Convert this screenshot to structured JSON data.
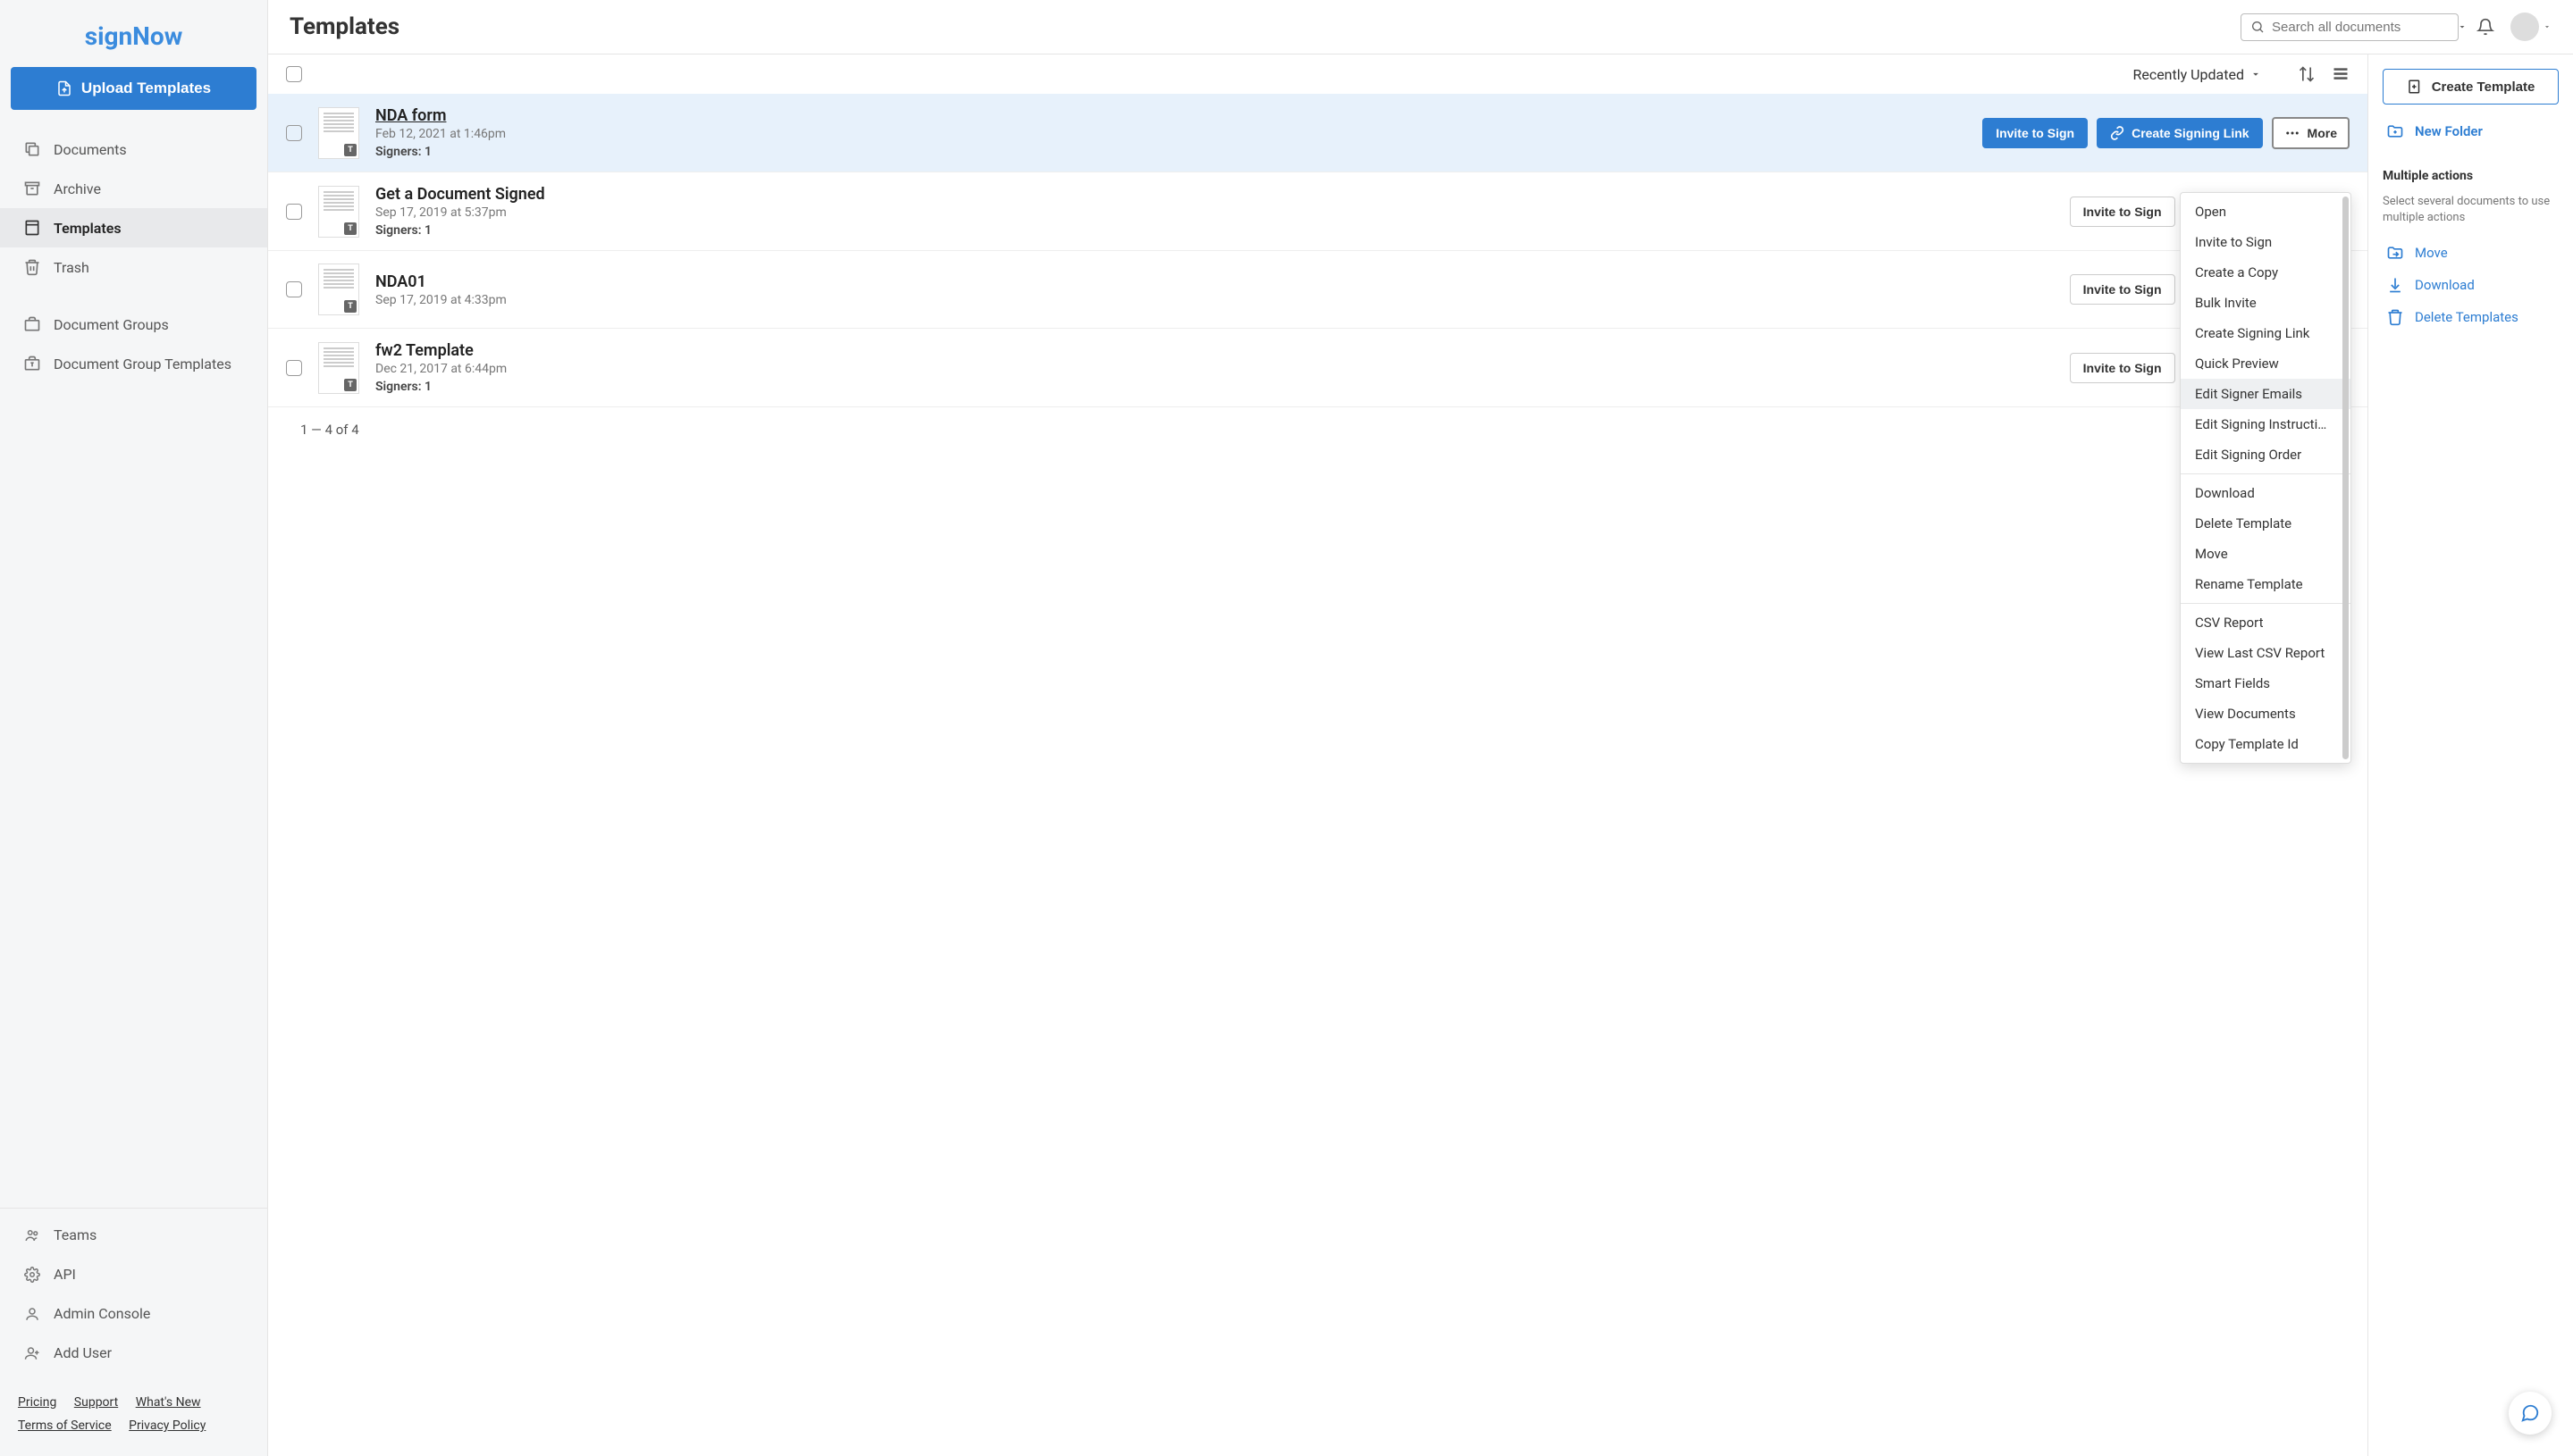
{
  "brand": "signNow",
  "upload_button": "Upload Templates",
  "nav": [
    {
      "label": "Documents",
      "icon": "copy"
    },
    {
      "label": "Archive",
      "icon": "archive"
    },
    {
      "label": "Templates",
      "icon": "templates",
      "active": true
    },
    {
      "label": "Trash",
      "icon": "trash"
    }
  ],
  "nav_secondary": [
    {
      "label": "Document Groups",
      "icon": "briefcase"
    },
    {
      "label": "Document Group Templates",
      "icon": "briefcase-t"
    }
  ],
  "nav_bottom": [
    {
      "label": "Teams",
      "icon": "teams"
    },
    {
      "label": "API",
      "icon": "gear"
    },
    {
      "label": "Admin Console",
      "icon": "user"
    },
    {
      "label": "Add User",
      "icon": "user-plus"
    }
  ],
  "footer_links": [
    "Pricing",
    "Support",
    "What's New",
    "Terms of Service",
    "Privacy Policy"
  ],
  "page_title": "Templates",
  "search_placeholder": "Search all documents",
  "sort_label": "Recently Updated",
  "rows": [
    {
      "title": "NDA form",
      "date": "Feb 12, 2021 at 1:46pm",
      "signers": "Signers: 1",
      "active": true
    },
    {
      "title": "Get a Document Signed",
      "date": "Sep 17, 2019 at 5:37pm",
      "signers": "Signers: 1"
    },
    {
      "title": "NDA01",
      "date": "Sep 17, 2019 at 4:33pm",
      "signers": ""
    },
    {
      "title": "fw2 Template",
      "date": "Dec 21, 2017 at 6:44pm",
      "signers": "Signers: 1"
    }
  ],
  "actions": {
    "invite": "Invite to Sign",
    "create_link": "Create Signing Link",
    "more": "More"
  },
  "pagination": "1 — 4 of 4",
  "dropdown": {
    "group1": [
      "Open",
      "Invite to Sign",
      "Create a Copy",
      "Bulk Invite",
      "Create Signing Link",
      "Quick Preview",
      "Edit Signer Emails",
      "Edit Signing Instructi…",
      "Edit Signing Order"
    ],
    "group2": [
      "Download",
      "Delete Template",
      "Move",
      "Rename Template"
    ],
    "group3": [
      "CSV Report",
      "View Last CSV Report",
      "Smart Fields",
      "View Documents",
      "Copy Template Id"
    ],
    "highlighted": "Edit Signer Emails"
  },
  "right_panel": {
    "create_template": "Create Template",
    "new_folder": "New Folder",
    "multi_title": "Multiple actions",
    "multi_desc": "Select several documents to use multiple actions",
    "actions": [
      "Move",
      "Download",
      "Delete Templates"
    ]
  }
}
